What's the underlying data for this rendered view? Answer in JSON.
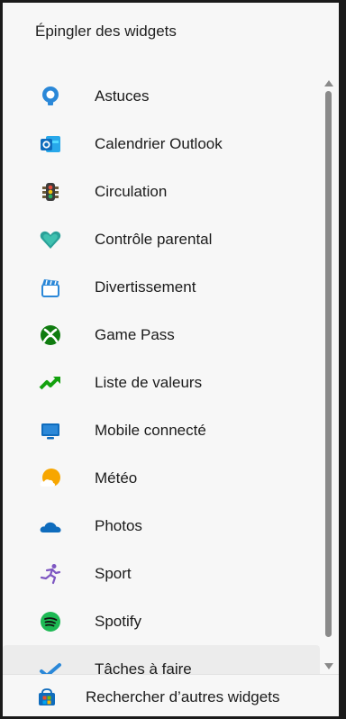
{
  "panel": {
    "title": "Épingler des widgets"
  },
  "widgets": [
    {
      "label": "Astuces",
      "icon": "lightbulb-icon"
    },
    {
      "label": "Calendrier Outlook",
      "icon": "outlook-calendar-icon"
    },
    {
      "label": "Circulation",
      "icon": "traffic-light-icon"
    },
    {
      "label": "Contrôle parental",
      "icon": "family-heart-icon"
    },
    {
      "label": "Divertissement",
      "icon": "clapperboard-icon"
    },
    {
      "label": "Game Pass",
      "icon": "xbox-icon"
    },
    {
      "label": "Liste de valeurs",
      "icon": "stock-trend-icon"
    },
    {
      "label": "Mobile connecté",
      "icon": "phone-link-icon"
    },
    {
      "label": "Météo",
      "icon": "weather-sun-cloud-icon"
    },
    {
      "label": "Photos",
      "icon": "onedrive-cloud-icon"
    },
    {
      "label": "Sport",
      "icon": "runner-icon"
    },
    {
      "label": "Spotify",
      "icon": "spotify-icon"
    },
    {
      "label": "Tâches à faire",
      "icon": "todo-check-icon"
    }
  ],
  "footer": {
    "label": "Rechercher d’autres widgets",
    "icon": "microsoft-store-icon"
  },
  "colors": {
    "accent_blue": "#0f6cbd",
    "border": "#1a1a1a",
    "panel_bg": "#f7f7f7",
    "scrollbar": "#8a8a8a"
  }
}
